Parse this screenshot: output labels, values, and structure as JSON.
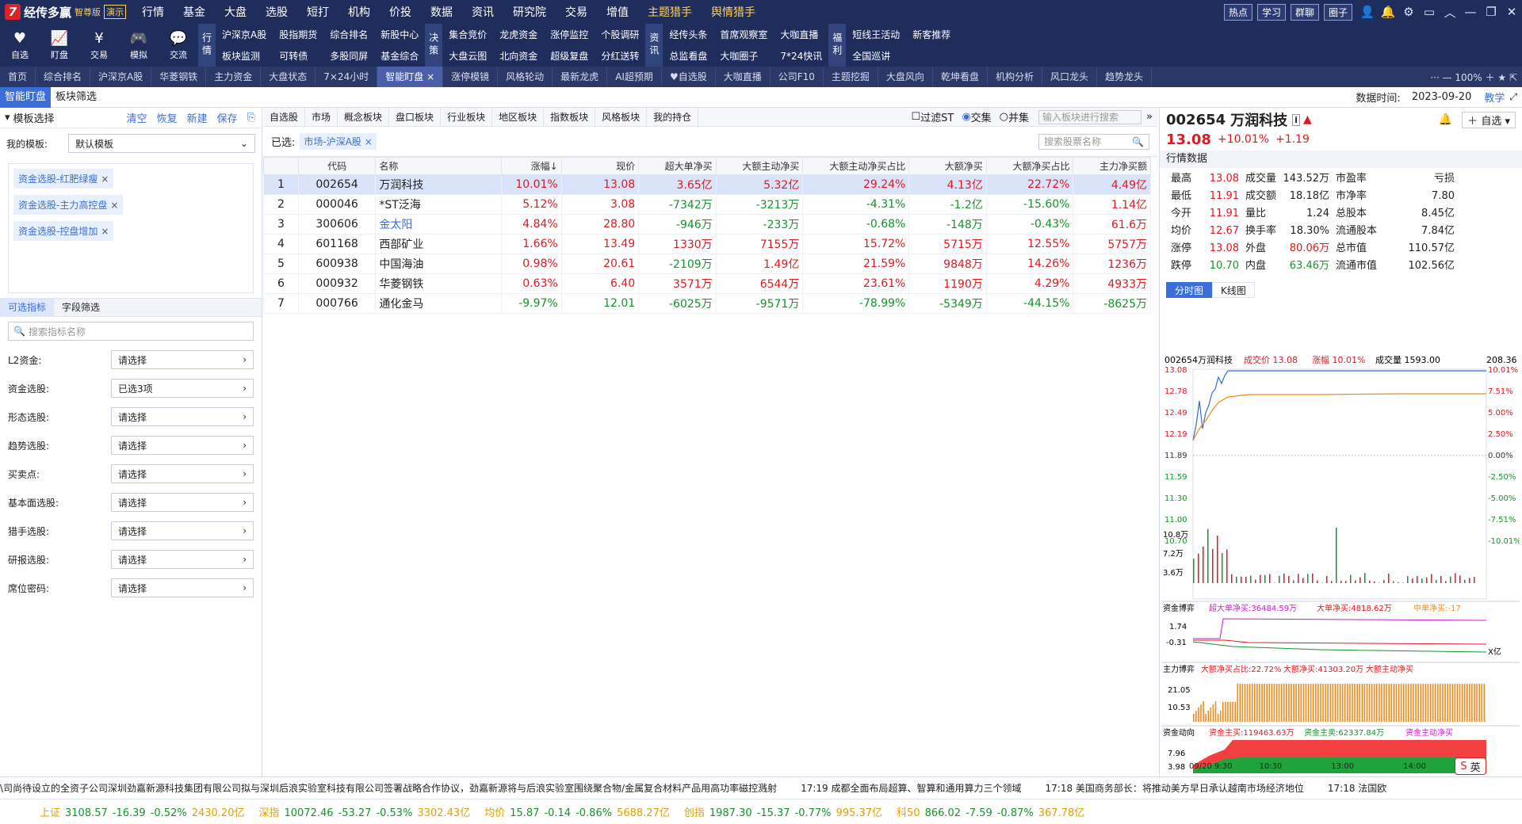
{
  "app": {
    "name": "经传多赢",
    "edition": "智尊版",
    "demo": "演示"
  },
  "menu": [
    "行情",
    "基金",
    "大盘",
    "选股",
    "短打",
    "机构",
    "价投",
    "数据",
    "资讯",
    "研究院",
    "交易",
    "增值",
    "主题猎手",
    "舆情猎手"
  ],
  "top_right_buttons": [
    "热点",
    "学习",
    "群聊",
    "圈子"
  ],
  "tools": [
    {
      "label": "自选",
      "icon": "heart-icon"
    },
    {
      "label": "盯盘",
      "icon": "monitor-icon"
    },
    {
      "label": "交易",
      "icon": "coin-icon"
    },
    {
      "label": "模拟",
      "icon": "gamepad-icon"
    },
    {
      "label": "交流",
      "icon": "chat-icon"
    }
  ],
  "toolbar_groups": [
    {
      "vtab": "行情",
      "items": [
        "沪深京A股",
        "板块监测",
        "股指期货",
        "可转债",
        "综合排名",
        "多股同屏",
        "新股中心",
        "基金综合"
      ]
    },
    {
      "vtab": "决策",
      "items": [
        "集合竞价",
        "大盘云图",
        "龙虎资金",
        "北向资金",
        "涨停监控",
        "超级复盘",
        "个股调研",
        "分红送转"
      ]
    },
    {
      "vtab": "资讯",
      "items": [
        "经传头条",
        "总监看盘",
        "首席观察室",
        "大咖圈子",
        "大咖直播",
        "7*24快讯"
      ]
    },
    {
      "vtab": "福利",
      "items": [
        "短线王活动",
        "全国巡讲",
        "新客推荐"
      ]
    }
  ],
  "tabbar": [
    "首页",
    "综合排名",
    "沪深京A股",
    "华菱钢铁",
    "主力资金",
    "大盘状态",
    "7×24小时",
    "智能盯盘 ×",
    "涨停模镜",
    "风格轮动",
    "最新龙虎",
    "AI超预期",
    "♥自选股",
    "大咖直播",
    "公司F10",
    "主题挖掘",
    "大盘风向",
    "乾坤看盘",
    "机构分析",
    "风口龙头",
    "趋势龙头"
  ],
  "tabbar_zoom": "100%",
  "subtabs": [
    "智能盯盘",
    "板块筛选"
  ],
  "data_time_label": "数据时间:",
  "data_time": "2023-09-20",
  "teach": "教学",
  "left": {
    "title": "模板选择",
    "links": [
      "清空",
      "恢复",
      "新建",
      "保存"
    ],
    "my_template_label": "我的模板:",
    "my_template_value": "默认模板",
    "tags": [
      "资金选股-红肥绿瘦",
      "资金选股-主力高控盘",
      "资金选股-控盘增加"
    ],
    "ftabs": [
      "可选指标",
      "字段筛选"
    ],
    "search_placeholder": "搜索指标名称",
    "filters": [
      {
        "label": "L2资金:",
        "value": "请选择"
      },
      {
        "label": "资金选股:",
        "value": "已选3项"
      },
      {
        "label": "形态选股:",
        "value": "请选择"
      },
      {
        "label": "趋势选股:",
        "value": "请选择"
      },
      {
        "label": "买卖点:",
        "value": "请选择"
      },
      {
        "label": "基本面选股:",
        "value": "请选择"
      },
      {
        "label": "猎手选股:",
        "value": "请选择"
      },
      {
        "label": "研报选股:",
        "value": "请选择"
      },
      {
        "label": "席位密码:",
        "value": "请选择"
      }
    ]
  },
  "center": {
    "tabs": [
      "自选股",
      "市场",
      "概念板块",
      "盘口板块",
      "行业板块",
      "地区板块",
      "指数板块",
      "风格板块",
      "我的持仓"
    ],
    "filter_st": "过滤ST",
    "intersect": "交集",
    "union": "并集",
    "sector_search_placeholder": "输入板块进行搜索",
    "chosen_label": "已选:",
    "chosen_chip": "市场-沪深A股",
    "stock_search_placeholder": "搜索股票名称",
    "columns": [
      "",
      "代码",
      "名称",
      "涨幅↓",
      "现价",
      "超大单净买",
      "大额主动净买",
      "大额主动净买占比",
      "大额净买",
      "大额净买占比",
      "主力净买额"
    ],
    "rows": [
      [
        "1",
        "002654",
        "万润科技",
        "10.01%",
        "13.08",
        "3.65亿",
        "5.32亿",
        "29.24%",
        "4.13亿",
        "22.72%",
        "4.49亿"
      ],
      [
        "2",
        "000046",
        "*ST泛海",
        "5.12%",
        "3.08",
        "-7342万",
        "-3213万",
        "-4.31%",
        "-1.2亿",
        "-15.60%",
        "1.14亿"
      ],
      [
        "3",
        "300606",
        "金太阳",
        "4.84%",
        "28.80",
        "-946万",
        "-233万",
        "-0.68%",
        "-148万",
        "-0.43%",
        "61.6万"
      ],
      [
        "4",
        "601168",
        "西部矿业",
        "1.66%",
        "13.49",
        "1330万",
        "7155万",
        "15.72%",
        "5715万",
        "12.55%",
        "5757万"
      ],
      [
        "5",
        "600938",
        "中国海油",
        "0.98%",
        "20.61",
        "-2109万",
        "1.49亿",
        "21.59%",
        "9848万",
        "14.26%",
        "1236万"
      ],
      [
        "6",
        "000932",
        "华菱钢铁",
        "0.63%",
        "6.40",
        "3571万",
        "6544万",
        "23.61%",
        "1190万",
        "4.29%",
        "4933万"
      ],
      [
        "7",
        "000766",
        "通化金马",
        "-9.97%",
        "12.01",
        "-6025万",
        "-9571万",
        "-78.99%",
        "-5349万",
        "-44.15%",
        "-8625万"
      ]
    ]
  },
  "right": {
    "code": "002654",
    "name": "万润科技",
    "price": "13.08",
    "pct": "+10.01%",
    "chg": "+1.19",
    "add_watch": "自选",
    "quote_title": "行情数据",
    "quote": [
      [
        "最高",
        "13.08",
        "成交量",
        "143.52万",
        "市盈率",
        "亏损"
      ],
      [
        "最低",
        "11.91",
        "成交额",
        "18.18亿",
        "市净率",
        "7.80"
      ],
      [
        "今开",
        "11.91",
        "量比",
        "1.24",
        "总股本",
        "8.45亿"
      ],
      [
        "均价",
        "12.67",
        "换手率",
        "18.30%",
        "流通股本",
        "7.84亿"
      ],
      [
        "涨停",
        "13.08",
        "外盘",
        "80.06万",
        "总市值",
        "110.57亿"
      ],
      [
        "跌停",
        "10.70",
        "内盘",
        "63.46万",
        "流通市值",
        "102.56亿"
      ]
    ],
    "chart_tabs": [
      "分时图",
      "K线图"
    ],
    "chart_info": {
      "name": "002654万润科技",
      "price_label": "成交价 13.08",
      "pct_label": "涨幅 10.01%",
      "vol_label": "成交量 1593.00",
      "extra": "208.36"
    },
    "y_left": [
      "13.08",
      "12.78",
      "12.49",
      "12.19",
      "11.89",
      "11.59",
      "11.30",
      "11.00",
      "10.70"
    ],
    "y_right": [
      "10.01%",
      "7.51%",
      "5.00%",
      "2.50%",
      "0.00%",
      "-2.50%",
      "-5.00%",
      "-7.51%",
      "-10.01%"
    ],
    "vol_axis": [
      "10.8万",
      "7.2万",
      "3.6万"
    ],
    "sub1": {
      "title": "资金博弈",
      "l1": "超大单净买:36484.59万",
      "l2": "大单净买:4818.62万",
      "l3": "中单净买:-17",
      "ax": [
        "1.74",
        "-0.31"
      ],
      "unit": "X亿"
    },
    "sub2": {
      "title": "主力博弈",
      "l1": "大额净买占比:22.72%",
      "l2": "大额净买:41303.20万",
      "l3": "大额主动净买",
      "ax": [
        "21.05",
        "10.53"
      ]
    },
    "sub3": {
      "title": "资金动向",
      "l1": "资金主买:119463.63万",
      "l2": "资金主卖:62337.84万",
      "l3": "资金主动净买",
      "ax": [
        "7.96",
        "3.98"
      ],
      "unit": "X亿"
    },
    "x_axis": [
      "09/20 9:30",
      "10:30",
      "13:00",
      "14:00"
    ]
  },
  "news": [
    "\\司尚待设立的全资子公司深圳劲嘉新源科技集团有限公司拟与深圳后浪实验室科技有限公司签署战略合作协议，劲嘉新源将与后浪实验室围绕聚合物/金属复合材料产品用高功率磁控溅射",
    "17:19 成都全面布局超算、智算和通用算力三个领域",
    "17:18 美国商务部长：将推动美方早日承认越南市场经济地位",
    "17:18 法国欧"
  ],
  "indices": [
    {
      "name": "上证",
      "v": "3108.57",
      "c": "-16.39",
      "p": "-0.52%",
      "a": "2430.20亿"
    },
    {
      "name": "深指",
      "v": "10072.46",
      "c": "-53.27",
      "p": "-0.53%",
      "a": "3302.43亿"
    },
    {
      "name": "均价",
      "v": "15.87",
      "c": "-0.14",
      "p": "-0.86%",
      "a": "5688.27亿"
    },
    {
      "name": "创指",
      "v": "1987.30",
      "c": "-15.37",
      "p": "-0.77%",
      "a": "995.37亿"
    },
    {
      "name": "科50",
      "v": "866.02",
      "c": "-7.59",
      "p": "-0.87%",
      "a": "367.78亿"
    }
  ],
  "ime": "英"
}
